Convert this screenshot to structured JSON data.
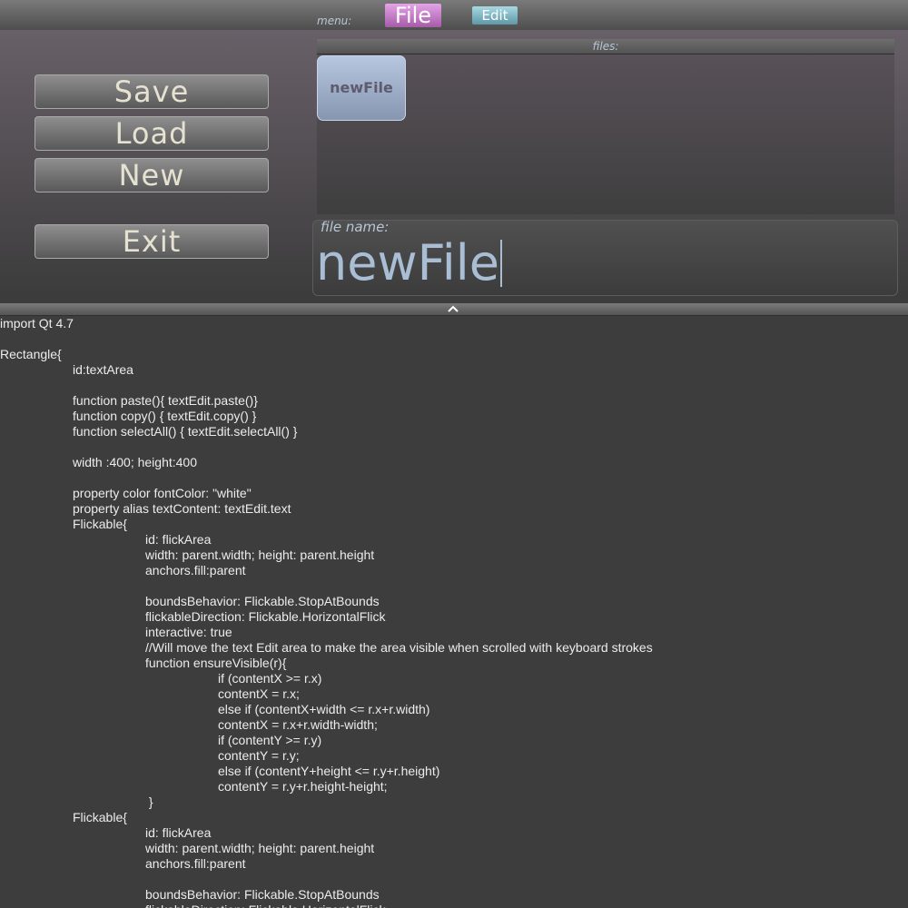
{
  "menu": {
    "label": "menu:",
    "items": [
      "File",
      "Edit"
    ],
    "colors": {
      "file": "#c77fca",
      "edit": "#7db4c4"
    }
  },
  "actions": {
    "save": "Save",
    "load": "Load",
    "new": "New",
    "exit": "Exit"
  },
  "files": {
    "label": "files:",
    "items": [
      "newFile"
    ]
  },
  "file_name": {
    "label": "file name:",
    "value": "newFile"
  },
  "splitter": {
    "icon": "chevron-up-icon"
  },
  "editor": {
    "lines": [
      {
        "indent": 0,
        "text": "import Qt 4.7"
      },
      {
        "indent": 0,
        "text": ""
      },
      {
        "indent": 0,
        "text": "Rectangle{"
      },
      {
        "indent": 1,
        "text": "id:textArea"
      },
      {
        "indent": 0,
        "text": ""
      },
      {
        "indent": 1,
        "text": "function paste(){ textEdit.paste()}"
      },
      {
        "indent": 1,
        "text": "function copy() { textEdit.copy() }"
      },
      {
        "indent": 1,
        "text": "function selectAll() { textEdit.selectAll() }"
      },
      {
        "indent": 0,
        "text": ""
      },
      {
        "indent": 1,
        "text": "width :400; height:400"
      },
      {
        "indent": 0,
        "text": ""
      },
      {
        "indent": 1,
        "text": "property color fontColor: \"white\""
      },
      {
        "indent": 1,
        "text": "property alias textContent: textEdit.text"
      },
      {
        "indent": 1,
        "text": "Flickable{"
      },
      {
        "indent": 2,
        "text": "id: flickArea"
      },
      {
        "indent": 2,
        "text": "width: parent.width; height: parent.height"
      },
      {
        "indent": 2,
        "text": "anchors.fill:parent"
      },
      {
        "indent": 0,
        "text": ""
      },
      {
        "indent": 2,
        "text": "boundsBehavior: Flickable.StopAtBounds"
      },
      {
        "indent": 2,
        "text": "flickableDirection: Flickable.HorizontalFlick"
      },
      {
        "indent": 2,
        "text": "interactive: true"
      },
      {
        "indent": 2,
        "text": "//Will move the text Edit area to make the area visible when scrolled with keyboard strokes"
      },
      {
        "indent": 2,
        "text": "function ensureVisible(r){"
      },
      {
        "indent": 3,
        "text": "if (contentX >= r.x)"
      },
      {
        "indent": 3,
        "text": "contentX = r.x;"
      },
      {
        "indent": 3,
        "text": "else if (contentX+width <= r.x+r.width)"
      },
      {
        "indent": 3,
        "text": "contentX = r.x+r.width-width;"
      },
      {
        "indent": 3,
        "text": "if (contentY >= r.y)"
      },
      {
        "indent": 3,
        "text": "contentY = r.y;"
      },
      {
        "indent": 3,
        "text": "else if (contentY+height <= r.y+r.height)"
      },
      {
        "indent": 3,
        "text": "contentY = r.y+r.height-height;"
      },
      {
        "indent": 2,
        "text": " }"
      },
      {
        "indent": 1,
        "text": "Flickable{"
      },
      {
        "indent": 2,
        "text": "id: flickArea"
      },
      {
        "indent": 2,
        "text": "width: parent.width; height: parent.height"
      },
      {
        "indent": 2,
        "text": "anchors.fill:parent"
      },
      {
        "indent": 0,
        "text": ""
      },
      {
        "indent": 2,
        "text": "boundsBehavior: Flickable.StopAtBounds"
      },
      {
        "indent": 2,
        "text": "flickableDirection: Flickable.HorizontalFlick"
      }
    ]
  }
}
